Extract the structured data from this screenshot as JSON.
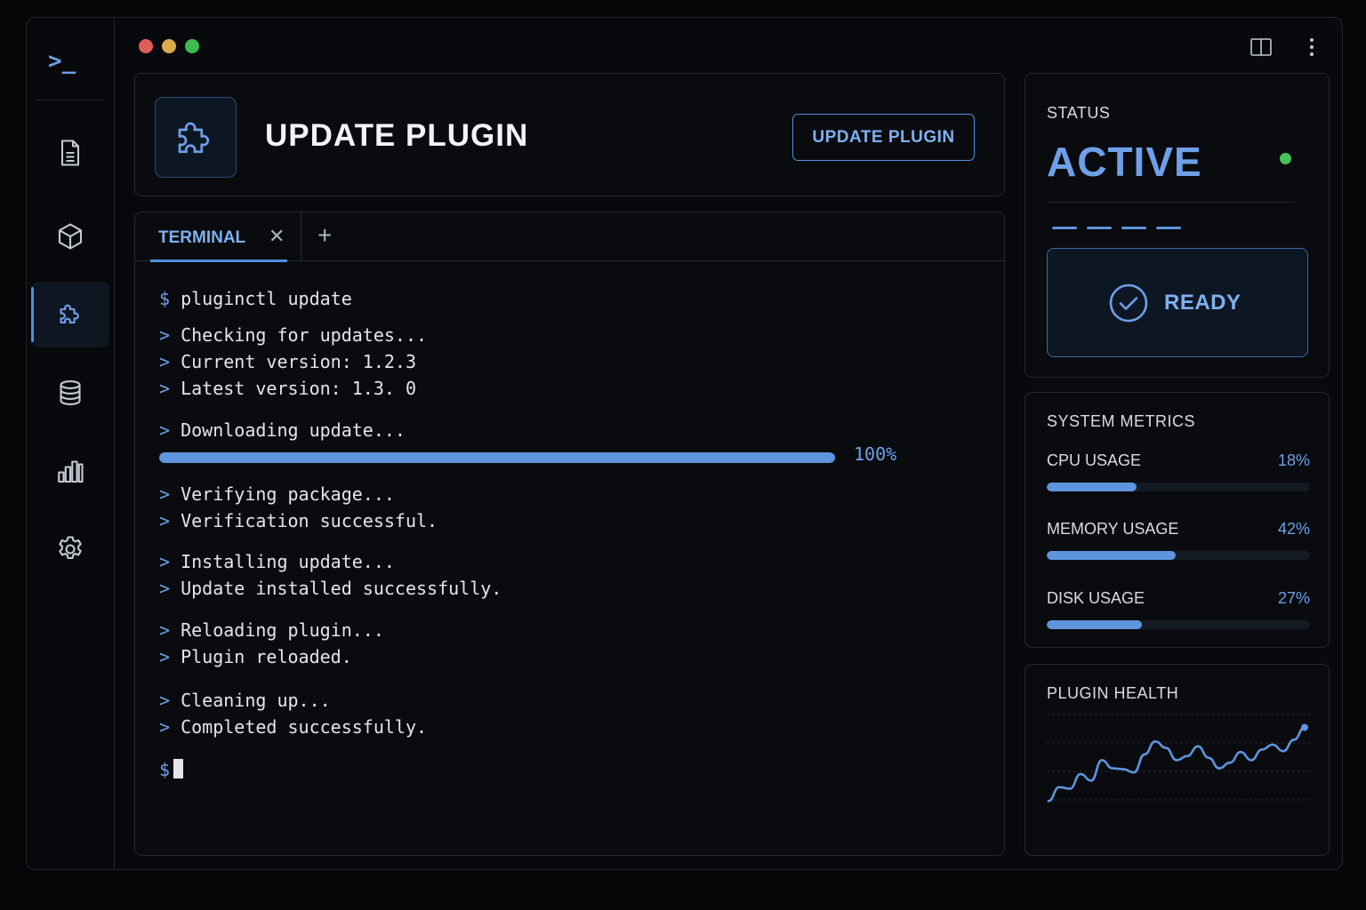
{
  "window": {
    "traffic_lights": {
      "close": "#e05c57",
      "minimize": "#d9ab4a",
      "maximize": "#3dba4e"
    },
    "controls": [
      "split-view-icon",
      "more-vertical-icon"
    ]
  },
  "sidebar": {
    "logo": ">_",
    "items": [
      {
        "icon": "file-icon",
        "active": false
      },
      {
        "icon": "cube-icon",
        "active": false
      },
      {
        "icon": "puzzle-icon",
        "active": true
      },
      {
        "icon": "database-icon",
        "active": false
      },
      {
        "icon": "bar-chart-icon",
        "active": false
      },
      {
        "icon": "gear-icon",
        "active": false
      }
    ]
  },
  "header": {
    "title": "UPDATE PLUGIN",
    "button_label": "UPDATE PLUGIN",
    "icon": "puzzle-icon"
  },
  "terminal": {
    "tab_label": "TERMINAL",
    "close_glyph": "✕",
    "add_glyph": "+",
    "prompt": "$",
    "arrow": ">",
    "command": "pluginctl update",
    "lines": [
      "Checking for updates...",
      "Current version: 1.2.3",
      "Latest version: 1.3. 0",
      "Downloading update...",
      "Verifying package...",
      "Verification successful.",
      "Installing update...",
      "Update installed successfully.",
      "Reloading plugin...",
      "Plugin reloaded.",
      "Cleaning up...",
      "Completed successfully."
    ],
    "download_progress": 100,
    "download_progress_label": "100%"
  },
  "status": {
    "label": "STATUS",
    "value": "ACTIVE",
    "indicator_color": "#47c25a",
    "ready_label": "READY",
    "ready_icon": "check-circle-icon"
  },
  "metrics": {
    "title": "SYSTEM METRICS",
    "items": [
      {
        "name": "CPU USAGE",
        "value": "18%",
        "percent": 34
      },
      {
        "name": "MEMORY USAGE",
        "value": "42%",
        "percent": 49
      },
      {
        "name": "DISK USAGE",
        "value": "27%",
        "percent": 36
      }
    ]
  },
  "health": {
    "title": "PLUGIN HEALTH"
  },
  "chart_data": {
    "type": "line",
    "title": "PLUGIN HEALTH",
    "xlabel": "",
    "ylabel": "",
    "grid": true,
    "ylim": [
      0,
      100
    ],
    "series": [
      {
        "values": [
          5,
          22,
          20,
          38,
          30,
          55,
          45,
          44,
          40,
          62,
          78,
          70,
          55,
          60,
          72,
          58,
          45,
          52,
          65,
          55,
          68,
          74,
          66,
          80,
          95
        ]
      }
    ],
    "color": "#5e95dd"
  }
}
